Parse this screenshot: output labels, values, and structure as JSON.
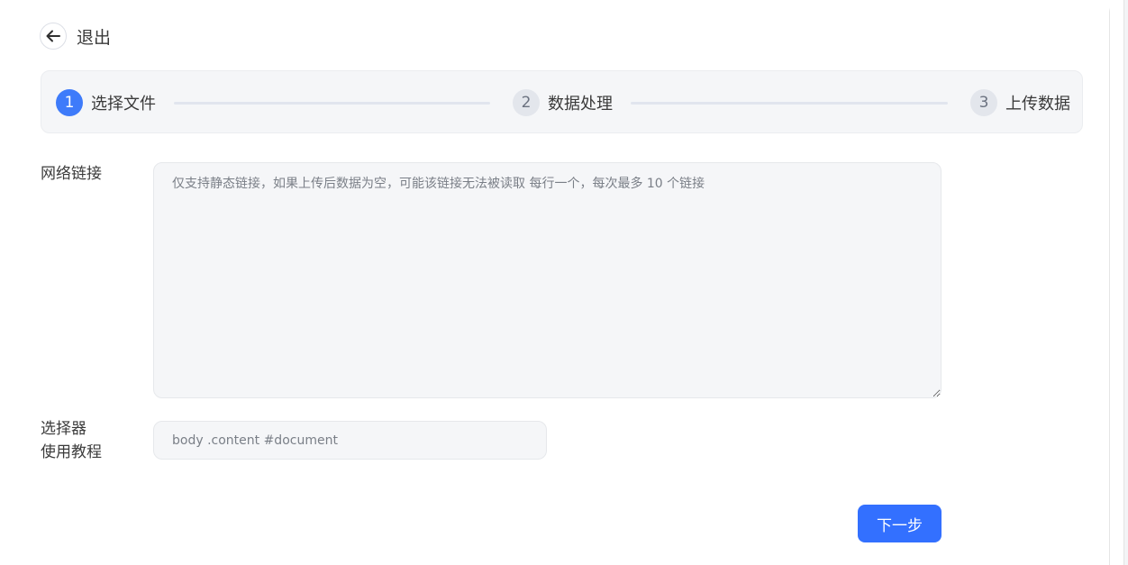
{
  "back": {
    "label": "退出",
    "icon": "arrow-left-icon"
  },
  "steps": [
    {
      "number": "1",
      "label": "选择文件",
      "state": "active"
    },
    {
      "number": "2",
      "label": "数据处理",
      "state": "pending"
    },
    {
      "number": "3",
      "label": "上传数据",
      "state": "pending"
    }
  ],
  "form": {
    "links": {
      "label": "网络链接",
      "placeholder": "仅支持静态链接，如果上传后数据为空，可能该链接无法被读取 每行一个，每次最多 10 个链接",
      "value": ""
    },
    "selector": {
      "label": "选择器",
      "help_link": "使用教程",
      "placeholder": "body .content #document",
      "value": ""
    }
  },
  "actions": {
    "next_label": "下一步"
  },
  "colors": {
    "accent": "#3370ff",
    "step_active": "#3e7bfa",
    "panel_bg": "#f5f6f8"
  }
}
